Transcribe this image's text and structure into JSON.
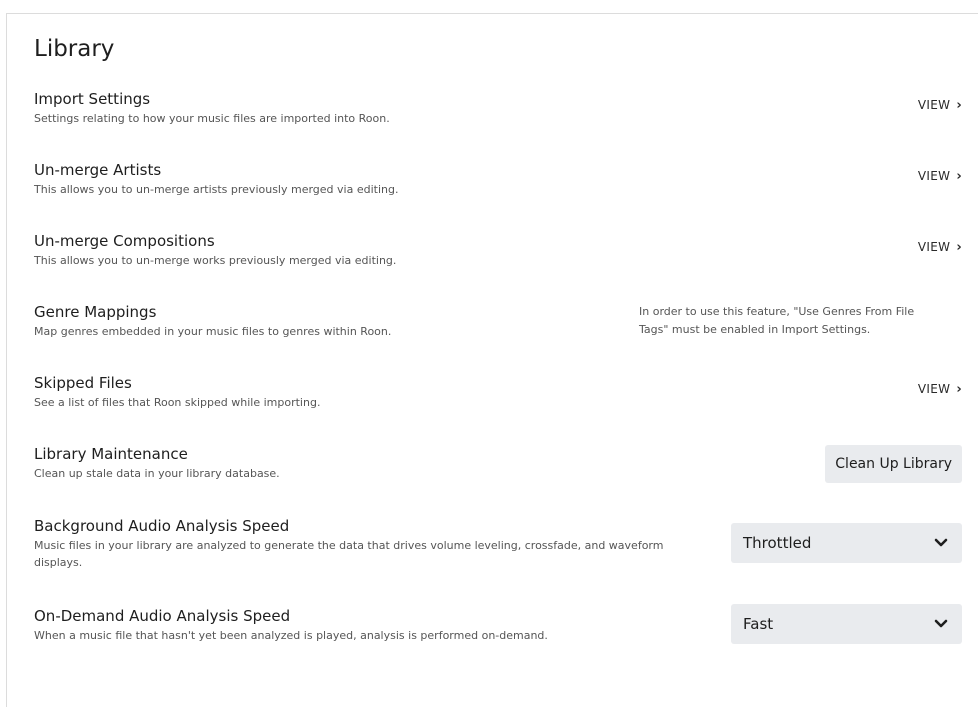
{
  "page": {
    "title": "Library"
  },
  "rows": {
    "import_settings": {
      "title": "Import Settings",
      "desc": "Settings relating to how your music files are imported into Roon.",
      "action": "VIEW"
    },
    "unmerge_artists": {
      "title": "Un-merge Artists",
      "desc": "This allows you to un-merge artists previously merged via editing.",
      "action": "VIEW"
    },
    "unmerge_compositions": {
      "title": "Un-merge Compositions",
      "desc": "This allows you to un-merge works previously merged via editing.",
      "action": "VIEW"
    },
    "genre_mappings": {
      "title": "Genre Mappings",
      "desc": "Map genres embedded in your music files to genres within Roon.",
      "note": "In order to use this feature, \"Use Genres From File Tags\" must be enabled in Import Settings."
    },
    "skipped_files": {
      "title": "Skipped Files",
      "desc": "See a list of files that Roon skipped while importing.",
      "action": "VIEW"
    },
    "library_maintenance": {
      "title": "Library Maintenance",
      "desc": "Clean up stale data in your library database.",
      "button": "Clean Up Library"
    },
    "background_analysis": {
      "title": "Background Audio Analysis Speed",
      "desc": "Music files in your library are analyzed to generate the data that drives volume leveling, crossfade, and waveform displays.",
      "selected": "Throttled"
    },
    "ondemand_analysis": {
      "title": "On-Demand Audio Analysis Speed",
      "desc": "When a music file that hasn't yet been analyzed is played, analysis is performed on-demand.",
      "selected": "Fast"
    }
  },
  "icons": {
    "chevron_right": "chevron-right-icon",
    "chevron_down": "chevron-down-icon"
  },
  "colors": {
    "control_bg": "#e9ebee",
    "text_primary": "#1e1e1e",
    "text_secondary": "#555555"
  }
}
